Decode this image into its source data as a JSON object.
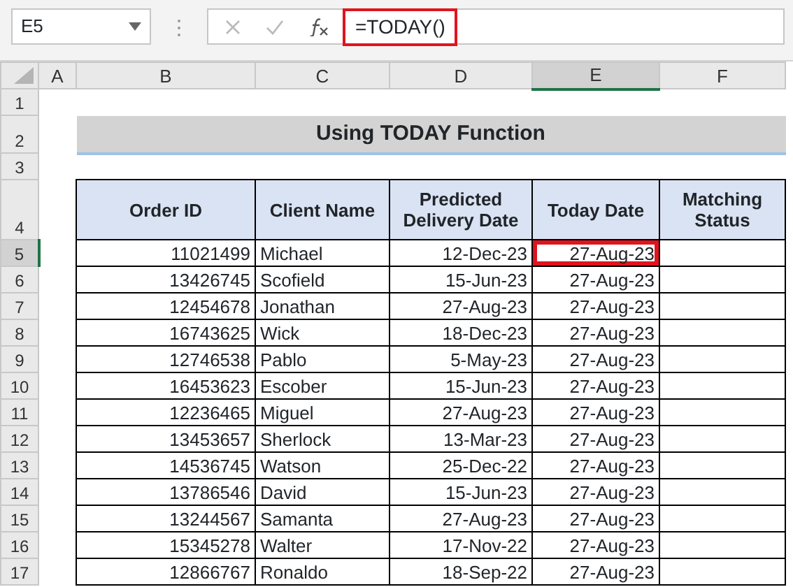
{
  "name_box": {
    "value": "E5"
  },
  "formula_bar": {
    "formula": "=TODAY()",
    "highlighted": true
  },
  "column_headers": [
    {
      "label": "A",
      "selected": false
    },
    {
      "label": "B",
      "selected": false
    },
    {
      "label": "C",
      "selected": false
    },
    {
      "label": "D",
      "selected": false
    },
    {
      "label": "E",
      "selected": true
    },
    {
      "label": "F",
      "selected": false
    }
  ],
  "row_headers": [
    {
      "label": "1",
      "selected": false
    },
    {
      "label": "2",
      "selected": false
    },
    {
      "label": "3",
      "selected": false
    },
    {
      "label": "4",
      "selected": false
    },
    {
      "label": "5",
      "selected": true
    },
    {
      "label": "6",
      "selected": false
    },
    {
      "label": "7",
      "selected": false
    },
    {
      "label": "8",
      "selected": false
    },
    {
      "label": "9",
      "selected": false
    },
    {
      "label": "10",
      "selected": false
    },
    {
      "label": "11",
      "selected": false
    },
    {
      "label": "12",
      "selected": false
    },
    {
      "label": "13",
      "selected": false
    },
    {
      "label": "14",
      "selected": false
    },
    {
      "label": "15",
      "selected": false
    },
    {
      "label": "16",
      "selected": false
    },
    {
      "label": "17",
      "selected": false
    }
  ],
  "title": "Using TODAY Function",
  "table": {
    "columns": [
      "Order ID",
      "Client Name",
      "Predicted Delivery Date",
      "Today Date",
      "Matching Status"
    ],
    "rows": [
      {
        "order_id": "11021499",
        "client_name": "Michael",
        "predicted_delivery_date": "12-Dec-23",
        "today_date": "27-Aug-23",
        "selected": true
      },
      {
        "order_id": "13426745",
        "client_name": "Scofield",
        "predicted_delivery_date": "15-Jun-23",
        "today_date": "27-Aug-23",
        "selected": false
      },
      {
        "order_id": "12454678",
        "client_name": "Jonathan",
        "predicted_delivery_date": "27-Aug-23",
        "today_date": "27-Aug-23",
        "selected": false
      },
      {
        "order_id": "16743625",
        "client_name": "Wick",
        "predicted_delivery_date": "18-Dec-23",
        "today_date": "27-Aug-23",
        "selected": false
      },
      {
        "order_id": "12746538",
        "client_name": "Pablo",
        "predicted_delivery_date": "5-May-23",
        "today_date": "27-Aug-23",
        "selected": false
      },
      {
        "order_id": "16453623",
        "client_name": "Escober",
        "predicted_delivery_date": "15-Jun-23",
        "today_date": "27-Aug-23",
        "selected": false
      },
      {
        "order_id": "12236465",
        "client_name": "Miguel",
        "predicted_delivery_date": "27-Aug-23",
        "today_date": "27-Aug-23",
        "selected": false
      },
      {
        "order_id": "13453657",
        "client_name": "Sherlock",
        "predicted_delivery_date": "13-Mar-23",
        "today_date": "27-Aug-23",
        "selected": false
      },
      {
        "order_id": "14536745",
        "client_name": "Watson",
        "predicted_delivery_date": "25-Dec-22",
        "today_date": "27-Aug-23",
        "selected": false
      },
      {
        "order_id": "13786546",
        "client_name": "David",
        "predicted_delivery_date": "15-Jun-23",
        "today_date": "27-Aug-23",
        "selected": false
      },
      {
        "order_id": "13244567",
        "client_name": "Samanta",
        "predicted_delivery_date": "27-Aug-23",
        "today_date": "27-Aug-23",
        "selected": false
      },
      {
        "order_id": "15345278",
        "client_name": "Walter",
        "predicted_delivery_date": "17-Nov-22",
        "today_date": "27-Aug-23",
        "selected": false
      },
      {
        "order_id": "12866767",
        "client_name": "Ronaldo",
        "predicted_delivery_date": "18-Sep-22",
        "today_date": "27-Aug-23",
        "selected": false
      }
    ]
  }
}
